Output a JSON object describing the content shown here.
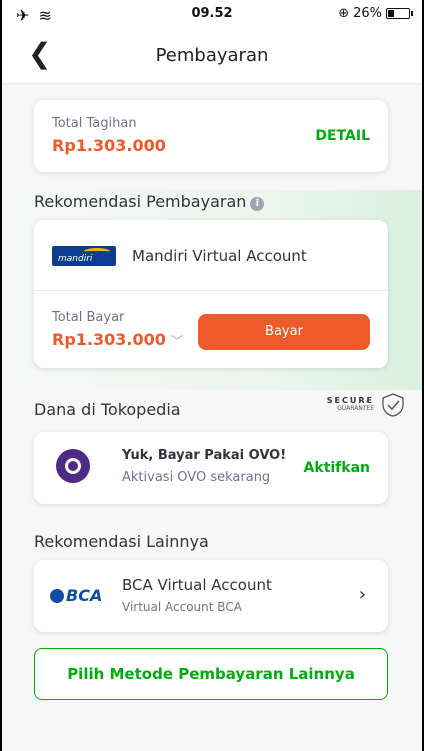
{
  "status_bar": {
    "time": "09.52",
    "battery": "26%",
    "battery_level": 0.26
  },
  "header": {
    "title": "Pembayaran"
  },
  "bill": {
    "label": "Total Tagihan",
    "amount": "Rp1.303.000",
    "detail_label": "DETAIL"
  },
  "recommended": {
    "title": "Rekomendasi Pembayaran",
    "method": "Mandiri Virtual Account",
    "total_label": "Total Bayar",
    "total_amount": "Rp1.303.000",
    "pay_label": "Bayar"
  },
  "wallet": {
    "title": "Dana di Tokopedia",
    "secure_line1": "SECURE",
    "secure_line2": "GUARANTEE",
    "ovo_title": "Yuk, Bayar Pakai OVO!",
    "ovo_subtitle": "Aktivasi OVO sekarang",
    "activate_label": "Aktifkan"
  },
  "others": {
    "title": "Rekomendasi Lainnya",
    "bca_title": "BCA Virtual Account",
    "bca_subtitle": "Virtual Account BCA"
  },
  "other_methods_label": "Pilih Metode Pembayaran Lainnya"
}
